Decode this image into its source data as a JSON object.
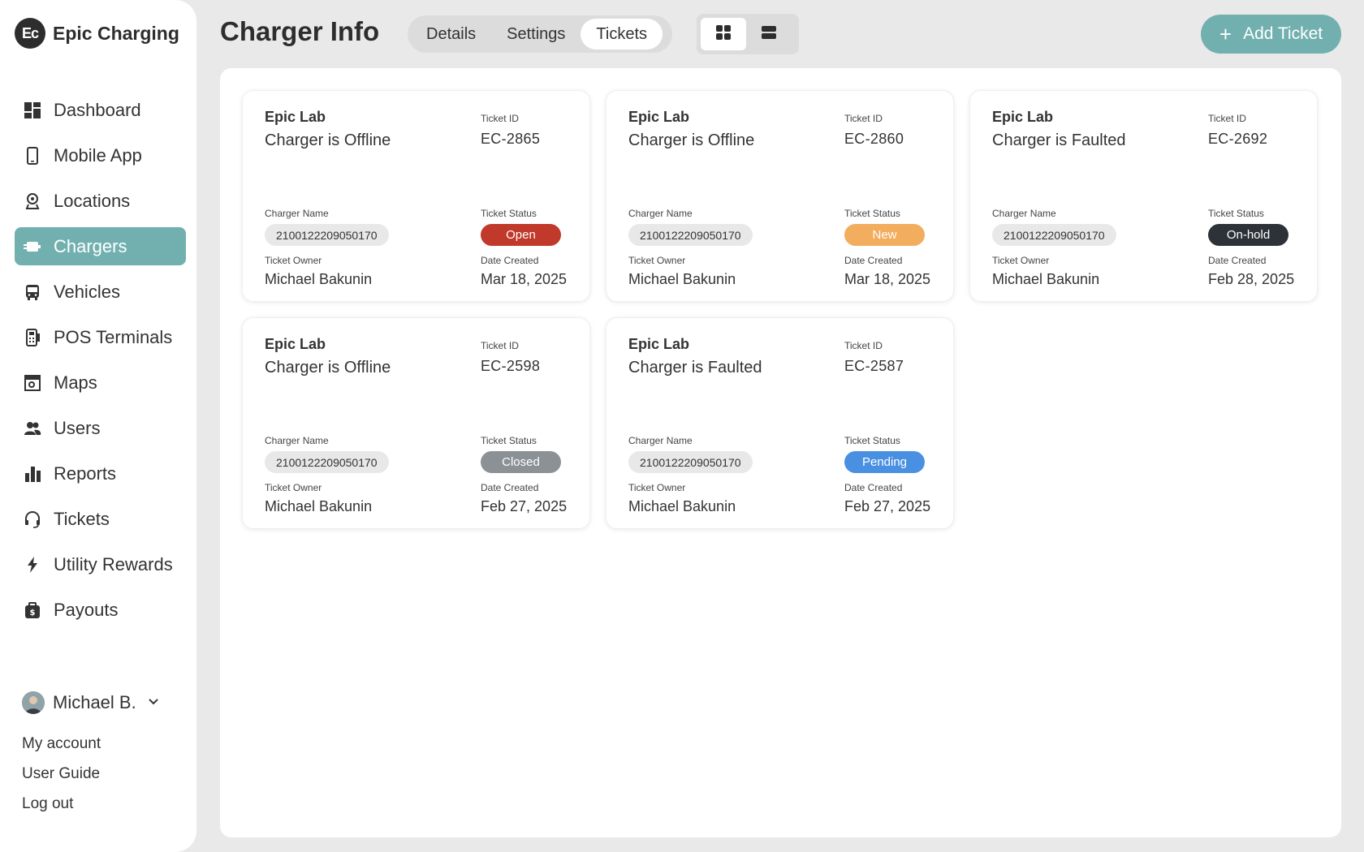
{
  "brand": {
    "logo_text": "Ec",
    "name": "Epic Charging"
  },
  "sidebar": {
    "items": [
      {
        "label": "Dashboard",
        "icon": "dashboard-icon"
      },
      {
        "label": "Mobile App",
        "icon": "mobile-icon"
      },
      {
        "label": "Locations",
        "icon": "location-pin-icon"
      },
      {
        "label": "Chargers",
        "icon": "charger-icon"
      },
      {
        "label": "Vehicles",
        "icon": "bus-icon"
      },
      {
        "label": "POS Terminals",
        "icon": "pos-terminal-icon"
      },
      {
        "label": "Maps",
        "icon": "map-icon"
      },
      {
        "label": "Users",
        "icon": "users-icon"
      },
      {
        "label": "Reports",
        "icon": "bar-chart-icon"
      },
      {
        "label": "Tickets",
        "icon": "headset-icon"
      },
      {
        "label": "Utility Rewards",
        "icon": "lightning-icon"
      },
      {
        "label": "Payouts",
        "icon": "wallet-icon"
      }
    ],
    "active_item": "Chargers"
  },
  "user": {
    "name": "Michael B.",
    "links": [
      "My account",
      "User Guide",
      "Log out"
    ]
  },
  "header": {
    "title": "Charger Info",
    "tabs": [
      "Details",
      "Settings",
      "Tickets"
    ],
    "active_tab": "Tickets",
    "add_button": "Add Ticket"
  },
  "labels": {
    "ticket_id": "Ticket ID",
    "charger_name": "Charger Name",
    "ticket_status": "Ticket Status",
    "ticket_owner": "Ticket Owner",
    "date_created": "Date Created"
  },
  "tickets": [
    {
      "site": "Epic Lab",
      "issue": "Charger is Offline",
      "id": "EC-2865",
      "charger": "2100122209050170",
      "status": "Open",
      "status_color": "#c0392b",
      "owner": "Michael Bakunin",
      "date": "Mar 18, 2025"
    },
    {
      "site": "Epic Lab",
      "issue": "Charger is Offline",
      "id": "EC-2860",
      "charger": "2100122209050170",
      "status": "New",
      "status_color": "#f2ad5f",
      "owner": "Michael Bakunin",
      "date": "Mar 18, 2025"
    },
    {
      "site": "Epic Lab",
      "issue": "Charger is Faulted",
      "id": "EC-2692",
      "charger": "2100122209050170",
      "status": "On-hold",
      "status_color": "#2c3237",
      "owner": "Michael Bakunin",
      "date": "Feb 28, 2025"
    },
    {
      "site": "Epic Lab",
      "issue": "Charger is Offline",
      "id": "EC-2598",
      "charger": "2100122209050170",
      "status": "Closed",
      "status_color": "#8c9196",
      "owner": "Michael Bakunin",
      "date": "Feb 27, 2025"
    },
    {
      "site": "Epic Lab",
      "issue": "Charger is Faulted",
      "id": "EC-2587",
      "charger": "2100122209050170",
      "status": "Pending",
      "status_color": "#4a90e2",
      "owner": "Michael Bakunin",
      "date": "Feb 27, 2025"
    }
  ],
  "colors": {
    "accent": "#72b0b0",
    "background": "#e9e9e9"
  }
}
